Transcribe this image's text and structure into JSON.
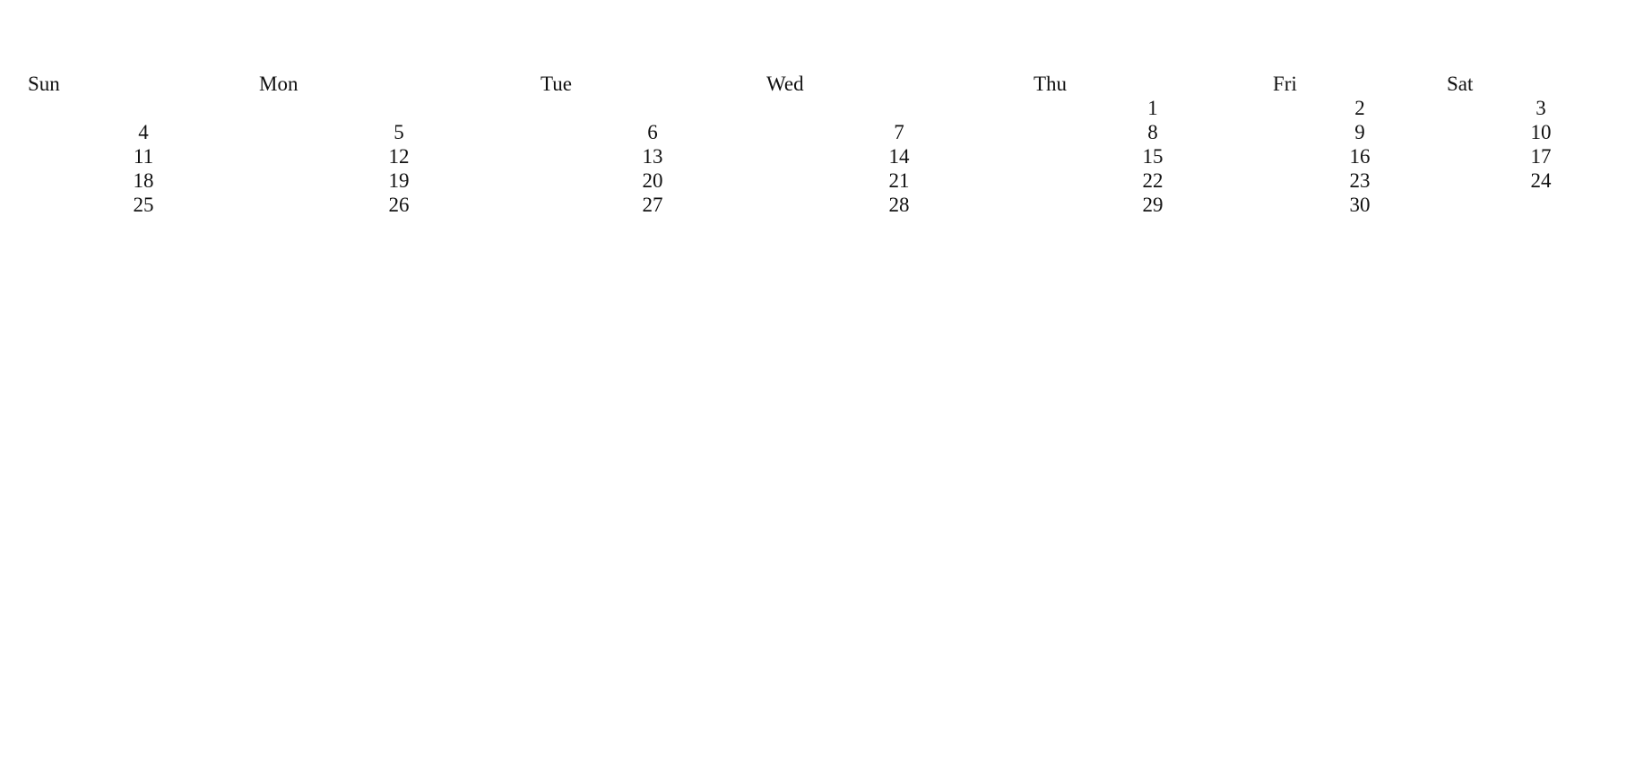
{
  "calendar": {
    "weekdays": [
      "Sun",
      "Mon",
      "Tue",
      "Wed",
      "Thu",
      "Fri",
      "Sat"
    ],
    "weeks": [
      [
        "",
        "",
        "",
        "",
        "1",
        "2",
        "3"
      ],
      [
        "4",
        "5",
        "6",
        "7",
        "8",
        "9",
        "10"
      ],
      [
        "11",
        "12",
        "13",
        "14",
        "15",
        "16",
        "17"
      ],
      [
        "18",
        "19",
        "20",
        "21",
        "22",
        "23",
        "24"
      ],
      [
        "25",
        "26",
        "27",
        "28",
        "29",
        "30",
        ""
      ]
    ]
  }
}
